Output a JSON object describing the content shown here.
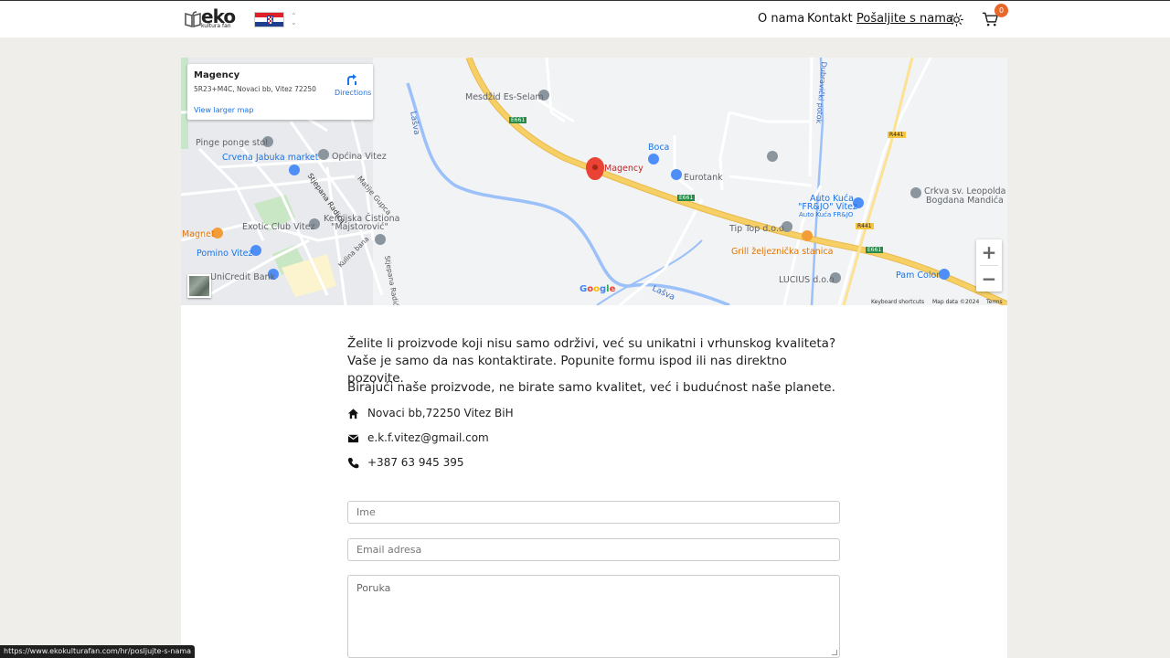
{
  "header": {
    "logo_text": "eko",
    "logo_subtext": "kultura fan",
    "language_flag": "croatia-flag-icon",
    "nav": [
      {
        "label": "O nama"
      },
      {
        "label": "Kontakt"
      },
      {
        "label": "Pošaljite s nama"
      }
    ],
    "theme_icon": "sun-icon",
    "cart_icon": "cart-icon",
    "cart_count": "0"
  },
  "map": {
    "info_card": {
      "title": "Magency",
      "address": "5R23+M4C, Novaci bb, Vitez 72250",
      "view_larger": "View larger map",
      "directions": "Directions"
    },
    "labels": {
      "mesdzid": "Mesdžid Es-Selam",
      "pinge": "Pinge ponge stol",
      "opcina": "Općina Vitez",
      "jabuka": "Crvena Jabuka market",
      "stjepana": "Stjepana Radića",
      "matije": "Matije Gupca",
      "kemijska1": "Kemijska Čistiona",
      "kemijska2": "\"Majstorović\"",
      "exotic": "Exotic Club Vitez",
      "magnet": "Magnet",
      "pomino": "Pomino Vitez",
      "kulina": "Kulina bana",
      "stjepana2": "Stjepana Radića",
      "unicredit": "UniCredit Bank",
      "lasva1": "Lašva",
      "lasva2": "Lašva",
      "magency": "Magency",
      "boca": "Boca",
      "eurotank": "Eurotank",
      "tiptop": "Tip Top d.o.o",
      "grill": "Grill željeznička stanica",
      "lucius": "LUCIUS d.o.o",
      "autokuca1": "Auto Kuća",
      "autokuca2": "\"FR&JO\" Vitez",
      "autokuca3": "Auto Kuća FR&JO",
      "crkva1": "Crkva sv. Leopolda",
      "crkva2": "Bogdana Mandića",
      "pamcolor": "Pam Color",
      "dubravicki": "Dubravički potok",
      "e661a": "E661",
      "e661b": "E661",
      "e661c": "E661",
      "r441a": "R441",
      "r441b": "R441"
    },
    "google": "Google",
    "footer": {
      "shortcuts": "Keyboard shortcuts",
      "data": "Map data ©2024",
      "terms": "Terms"
    }
  },
  "content": {
    "para1": "Želite li proizvode koji nisu samo održivi, već su unikatni i vrhunskog kvaliteta? Vaše je samo da nas kontaktirate. Popunite formu ispod ili nas direktno pozovite.",
    "para2": "Birajući naše proizvode, ne birate samo kvalitet, već i budućnost naše planete.",
    "address": "Novaci bb,72250 Vitez BiH",
    "email": "e.k.f.vitez@gmail.com",
    "phone": "+387 63 945 395"
  },
  "form": {
    "name_placeholder": "Ime",
    "email_placeholder": "Email adresa",
    "message_placeholder": "Poruka"
  },
  "statusbar": {
    "url": "https://www.ekokulturafan.com/hr/posljujte-s-nama"
  },
  "colors": {
    "accent": "#e8682a",
    "road": "#f6cf65",
    "water": "#9cc0f9",
    "link": "#1a73e8"
  }
}
